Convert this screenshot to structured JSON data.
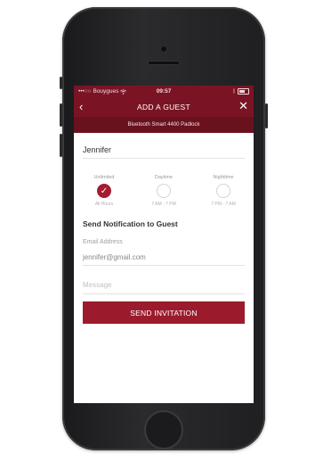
{
  "status_bar": {
    "carrier": "•••○○ Bouygues",
    "time": "09:57",
    "accent_color": "#7a1424"
  },
  "nav": {
    "title": "ADD A GUEST",
    "back_icon": "chevron-left-icon",
    "close_icon": "close-icon"
  },
  "device": {
    "name": "Bluetooth Smart 4400 Padlock"
  },
  "guest": {
    "name": "Jennifer"
  },
  "schedule": {
    "options": [
      {
        "label": "Unlimited",
        "time": "All Hours",
        "selected": true
      },
      {
        "label": "Daytime",
        "time": "7 AM - 7 PM",
        "selected": false
      },
      {
        "label": "Nighttime",
        "time": "7 PM - 7 AM",
        "selected": false
      }
    ]
  },
  "notification": {
    "title": "Send Notification to Guest",
    "email_label": "Email Address",
    "email_value": "jennifer@gmail.com",
    "message_placeholder": "Message"
  },
  "actions": {
    "send_label": "SEND INVITATION",
    "button_color": "#9b1b2c"
  }
}
